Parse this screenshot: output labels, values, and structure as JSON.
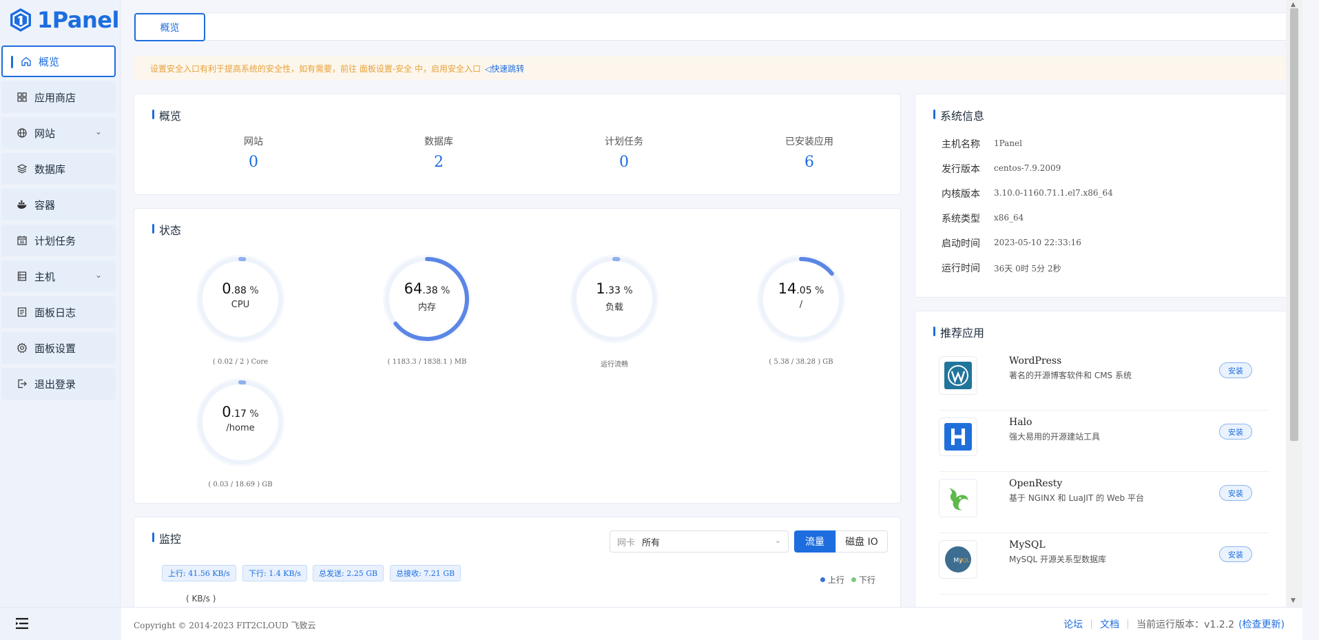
{
  "app": {
    "logo_text": "1Panel"
  },
  "sidebar": {
    "items": [
      {
        "label": "概览",
        "icon": "home-icon",
        "active": true
      },
      {
        "label": "应用商店",
        "icon": "grid-icon"
      },
      {
        "label": "网站",
        "icon": "globe-icon",
        "expandable": true
      },
      {
        "label": "数据库",
        "icon": "layers-icon"
      },
      {
        "label": "容器",
        "icon": "docker-icon"
      },
      {
        "label": "计划任务",
        "icon": "calendar-icon"
      },
      {
        "label": "主机",
        "icon": "server-icon",
        "expandable": true
      },
      {
        "label": "面板日志",
        "icon": "log-icon"
      },
      {
        "label": "面板设置",
        "icon": "gear-icon"
      },
      {
        "label": "退出登录",
        "icon": "logout-icon"
      }
    ]
  },
  "tabs": [
    {
      "label": "概览"
    }
  ],
  "alert": {
    "text": "设置安全入口有利于提高系统的安全性，如有需要，前往 面板设置-安全 中，启用安全入口",
    "link": "快速跳转"
  },
  "overview": {
    "title": "概览",
    "items": [
      {
        "label": "网站",
        "value": "0"
      },
      {
        "label": "数据库",
        "value": "2"
      },
      {
        "label": "计划任务",
        "value": "0"
      },
      {
        "label": "已安装应用",
        "value": "6"
      }
    ]
  },
  "status": {
    "title": "状态",
    "gauges": [
      {
        "int": "0",
        "dec": ".88",
        "unit": "%",
        "name": "CPU",
        "percent": 0.88,
        "foot": "( 0.02 / 2 ) Core"
      },
      {
        "int": "64",
        "dec": ".38",
        "unit": "%",
        "name": "内存",
        "percent": 64.38,
        "foot": "( 1183.3 / 1838.1 ) MB"
      },
      {
        "int": "1",
        "dec": ".33",
        "unit": "%",
        "name": "负载",
        "percent": 1.33,
        "foot": "运行流畅"
      },
      {
        "int": "14",
        "dec": ".05",
        "unit": "%",
        "name": "/",
        "percent": 14.05,
        "foot": "( 5.38 / 38.28 ) GB"
      },
      {
        "int": "0",
        "dec": ".17",
        "unit": "%",
        "name": "/home",
        "percent": 0.17,
        "foot": "( 0.03 / 18.69 ) GB"
      }
    ]
  },
  "monitor": {
    "title": "监控",
    "nic_label": "网卡",
    "nic_value": "所有",
    "seg_traffic": "流量",
    "seg_disk": "磁盘 IO",
    "chips": [
      "上行: 41.56 KB/s",
      "下行: 1.4 KB/s",
      "总发送: 2.25 GB",
      "总接收: 7.21 GB"
    ],
    "legend_up": "上行",
    "legend_down": "下行",
    "unit": "( KB/s )",
    "colors": {
      "up": "#3b6fd8",
      "down": "#7ec87a"
    }
  },
  "sysinfo": {
    "title": "系统信息",
    "rows": [
      {
        "label": "主机名称",
        "value": "1Panel"
      },
      {
        "label": "发行版本",
        "value": "centos-7.9.2009"
      },
      {
        "label": "内核版本",
        "value": "3.10.0-1160.71.1.el7.x86_64"
      },
      {
        "label": "系统类型",
        "value": "x86_64"
      },
      {
        "label": "启动时间",
        "value": "2023-05-10 22:33:16"
      },
      {
        "label": "运行时间",
        "value": "36天 0时 5分 2秒"
      }
    ]
  },
  "apps": {
    "title": "推荐应用",
    "install_label": "安装",
    "items": [
      {
        "name": "WordPress",
        "desc": "著名的开源博客软件和 CMS 系统",
        "icon": "wordpress-icon"
      },
      {
        "name": "Halo",
        "desc": "强大易用的开源建站工具",
        "icon": "halo-icon"
      },
      {
        "name": "OpenResty",
        "desc": "基于 NGINX 和 LuaJIT 的 Web 平台",
        "icon": "openresty-icon"
      },
      {
        "name": "MySQL",
        "desc": "MySQL 开源关系型数据库",
        "icon": "mysql-icon"
      }
    ]
  },
  "footer": {
    "copyright": "Copyright © 2014-2023 FIT2CLOUD 飞致云",
    "forum": "论坛",
    "docs": "文档",
    "version_text": "当前运行版本：v1.2.2",
    "check_update": "(检查更新)"
  },
  "colors": {
    "accent": "#1d6ddf",
    "alert_text": "#e6a23c",
    "alert_bg": "#fdf6ec"
  }
}
